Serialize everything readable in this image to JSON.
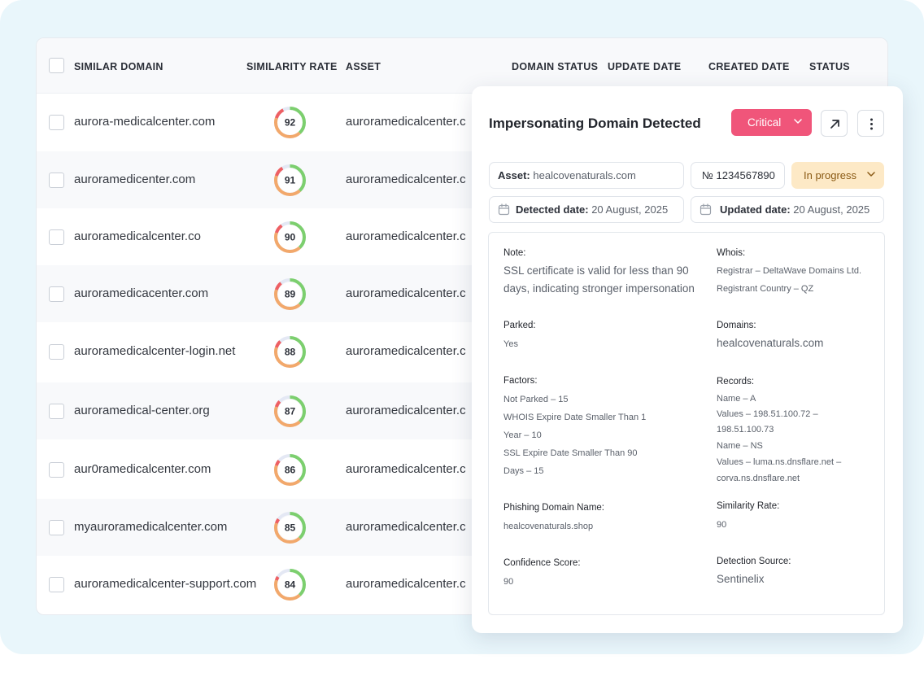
{
  "table": {
    "headers": {
      "similar_domain": "SIMILAR DOMAIN",
      "similarity_rate": "SIMILARITY RATE",
      "asset": "ASSET",
      "domain_status": "DOMAIN STATUS",
      "update_date": "UPDATE DATE",
      "created_date": "CREATED DATE",
      "status": "STATUS"
    },
    "rows": [
      {
        "domain": "aurora-medicalcenter.com",
        "rate": 92,
        "asset": "auroramedicalcenter.c"
      },
      {
        "domain": "auroramedicenter.com",
        "rate": 91,
        "asset": "auroramedicalcenter.c"
      },
      {
        "domain": "auroramedicalcenter.co",
        "rate": 90,
        "asset": "auroramedicalcenter.c"
      },
      {
        "domain": "auroramedicacenter.com",
        "rate": 89,
        "asset": "auroramedicalcenter.c"
      },
      {
        "domain": "auroramedicalcenter-login.net",
        "rate": 88,
        "asset": "auroramedicalcenter.c"
      },
      {
        "domain": "auroramedical-center.org",
        "rate": 87,
        "asset": "auroramedicalcenter.c"
      },
      {
        "domain": "aur0ramedicalcenter.com",
        "rate": 86,
        "asset": "auroramedicalcenter.c"
      },
      {
        "domain": "myauroramedicalcenter.com",
        "rate": 85,
        "asset": "auroramedicalcenter.c"
      },
      {
        "domain": "auroramedicalcenter-support.com",
        "rate": 84,
        "asset": "auroramedicalcenter.c"
      }
    ]
  },
  "detail": {
    "title": "Impersonating Domain Detected",
    "severity": "Critical",
    "asset_label": "Asset:",
    "asset_value": "healcovenaturals.com",
    "number": "№ 1234567890",
    "status": "In progress",
    "detected_label": "Detected date:",
    "detected_value": "20 August, 2025",
    "updated_label": "Updated date:",
    "updated_value": "20 August, 2025",
    "note_label": "Note:",
    "note_lines": [
      "SSL certificate is valid for less than 90",
      "days, indicating stronger impersonation"
    ],
    "whois_label": "Whois:",
    "whois_lines": [
      "Registrar – DeltaWave Domains Ltd.",
      "Registrant Country – QZ"
    ],
    "parked_label": "Parked:",
    "parked_value": "Yes",
    "domains_label": "Domains:",
    "domains_value": "healcovenaturals.com",
    "factors_label": "Factors:",
    "factors_lines": [
      "Not Parked – 15",
      "WHOIS Expire Date Smaller Than 1",
      "Year – 10",
      "SSL Expire Date Smaller Than 90",
      "Days – 15"
    ],
    "records_label": "Records:",
    "records_lines": [
      "Name – A",
      "Values – 198.51.100.72 –",
      "198.51.100.73",
      "Name – NS",
      "Values – luma.ns.dnsflare.net –",
      "corva.ns.dnsflare.net"
    ],
    "phishing_label": "Phishing Domain Name:",
    "phishing_value": "healcovenaturals.shop",
    "similarity_label": "Similarity Rate:",
    "similarity_value": "90",
    "confidence_label": "Confidence Score:",
    "confidence_value": "90",
    "source_label": "Detection Source:",
    "source_value": "Sentinelix"
  },
  "colors": {
    "critical": "#f0557a",
    "status_bg": "#fde9c6",
    "gauge_track": "#e4e8f4",
    "gauge_red": "#ee5f63",
    "gauge_orange": "#f2a86b",
    "gauge_green": "#7ccf6e"
  }
}
